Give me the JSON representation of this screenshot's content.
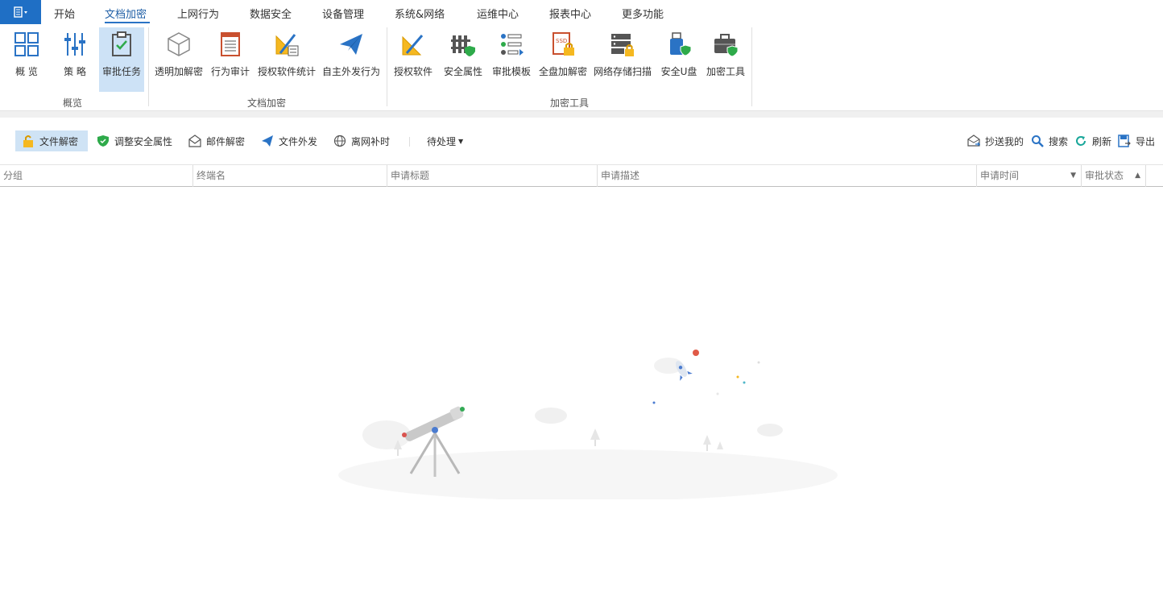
{
  "menu": {
    "items": [
      "开始",
      "文档加密",
      "上网行为",
      "数据安全",
      "设备管理",
      "系统&网络",
      "运维中心",
      "报表中心",
      "更多功能"
    ],
    "active": "文档加密"
  },
  "ribbon": {
    "groups": [
      {
        "label": "概览",
        "buttons": [
          {
            "label": "概 览",
            "icon": "grid-icon"
          },
          {
            "label": "策 略",
            "icon": "sliders-icon"
          },
          {
            "label": "审批任务",
            "icon": "clipboard-check-icon"
          }
        ]
      },
      {
        "label": "文档加密",
        "buttons": [
          {
            "label": "透明加解密",
            "icon": "cube-icon"
          },
          {
            "label": "行为审计",
            "icon": "document-list-icon"
          },
          {
            "label": "授权软件统计",
            "icon": "ruler-chart-icon"
          },
          {
            "label": "自主外发行为",
            "icon": "paper-plane-icon"
          }
        ]
      },
      {
        "label": "加密工具",
        "buttons": [
          {
            "label": "授权软件",
            "icon": "ruler-pencil-icon"
          },
          {
            "label": "安全属性",
            "icon": "fence-shield-icon"
          },
          {
            "label": "审批模板",
            "icon": "template-list-icon"
          },
          {
            "label": "全盘加解密",
            "icon": "ssd-lock-icon"
          },
          {
            "label": "网络存储扫描",
            "icon": "server-lock-icon"
          },
          {
            "label": "安全U盘",
            "icon": "usb-shield-icon"
          },
          {
            "label": "加密工具",
            "icon": "toolbox-shield-icon"
          }
        ]
      }
    ]
  },
  "toolbar": {
    "left": [
      {
        "label": "文件解密",
        "icon": "padlock-open-icon"
      },
      {
        "label": "调整安全属性",
        "icon": "shield-icon"
      },
      {
        "label": "邮件解密",
        "icon": "envelope-icon"
      },
      {
        "label": "文件外发",
        "icon": "paper-plane-icon"
      },
      {
        "label": "离网补时",
        "icon": "globe-icon"
      }
    ],
    "filter": "待处理",
    "right": [
      {
        "label": "抄送我的",
        "icon": "mail-cc-icon"
      },
      {
        "label": "搜索",
        "icon": "search-icon"
      },
      {
        "label": "刷新",
        "icon": "refresh-icon"
      },
      {
        "label": "导出",
        "icon": "export-icon"
      }
    ]
  },
  "table": {
    "columns": [
      "分组",
      "终端名",
      "申请标题",
      "申请描述",
      "申请时间",
      "审批状态"
    ]
  },
  "colors": {
    "accent": "#1f6fc5",
    "selected": "#cde2f6"
  }
}
